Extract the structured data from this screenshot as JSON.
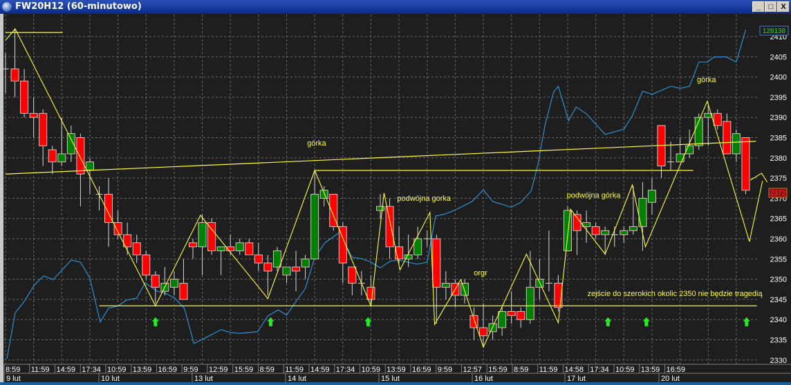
{
  "window": {
    "title": "FW20H12 (60-minutowo)",
    "buttons": {
      "minimize": "_",
      "maximize": "□",
      "close": "X"
    }
  },
  "colors": {
    "background": "#1e1e1e",
    "grid": "#6a6a6a",
    "up_candle": "#008000",
    "down_candle": "#ff0000",
    "candle_border": "#e0c0c0",
    "drawings": "#ffff33",
    "indicator_line": "#2f8fd0",
    "arrows": "#22ee22",
    "axis_text": "#ffffff"
  },
  "chart_data": {
    "type": "candlestick",
    "ylim": [
      2328,
      2413
    ],
    "y_ticks": [
      2330,
      2335,
      2340,
      2345,
      2350,
      2355,
      2360,
      2365,
      2370,
      2375,
      2380,
      2385,
      2390,
      2395,
      2400,
      2405,
      2410
    ],
    "grid": true,
    "x_time_labels": [
      "8:59",
      "11:59",
      "14:59",
      "17:34",
      "10:59",
      "13:59",
      "16:59",
      "9:59",
      "12:59",
      "15:59",
      "8:59",
      "11:59",
      "14:59",
      "17:34",
      "10:59",
      "13:59",
      "16:59",
      "9:59",
      "12:57",
      "15:59",
      "8:59",
      "11:59",
      "14:58",
      "17:34",
      "10:59",
      "13:59",
      "16:59"
    ],
    "x_date_labels": [
      {
        "label": "9 lut",
        "candle": 0
      },
      {
        "label": "10 lut",
        "candle": 10
      },
      {
        "label": "13 lut",
        "candle": 20
      },
      {
        "label": "14 lut",
        "candle": 30
      },
      {
        "label": "15 lut",
        "candle": 40
      },
      {
        "label": "16 lut",
        "candle": 50
      },
      {
        "label": "17 lut",
        "candle": 60
      },
      {
        "label": "20 lut",
        "candle": 70
      }
    ],
    "candles_ohlc": [
      [
        2402,
        2406,
        2396,
        2402
      ],
      [
        2402,
        2412,
        2395,
        2399
      ],
      [
        2399,
        2402,
        2390,
        2391
      ],
      [
        2391,
        2395,
        2385,
        2390
      ],
      [
        2391,
        2392,
        2378,
        2383
      ],
      [
        2382,
        2383,
        2376,
        2379
      ],
      [
        2379,
        2390,
        2378,
        2381
      ],
      [
        2381,
        2388,
        2379,
        2386
      ],
      [
        2385,
        2386,
        2368,
        2376
      ],
      [
        2377,
        2380,
        2371,
        2379
      ],
      [
        2371,
        2373,
        2367,
        2371
      ],
      [
        2371,
        2375,
        2358,
        2364
      ],
      [
        2364,
        2367,
        2360,
        2361
      ],
      [
        2361,
        2364,
        2356,
        2358
      ],
      [
        2359,
        2361,
        2354,
        2356
      ],
      [
        2356,
        2357,
        2350,
        2351
      ],
      [
        2351,
        2352,
        2344,
        2348
      ],
      [
        2347,
        2353,
        2346,
        2349
      ],
      [
        2348,
        2352,
        2346,
        2350
      ],
      [
        2349,
        2355,
        2345,
        2345
      ],
      [
        2359,
        2360,
        2355,
        2358
      ],
      [
        2358,
        2366,
        2351,
        2364
      ],
      [
        2364,
        2365,
        2356,
        2357
      ],
      [
        2357,
        2358,
        2351,
        2358
      ],
      [
        2358,
        2361,
        2356,
        2357
      ],
      [
        2357,
        2360,
        2356,
        2359
      ],
      [
        2359,
        2360,
        2356,
        2356
      ],
      [
        2356,
        2359,
        2352,
        2354
      ],
      [
        2354,
        2356,
        2346,
        2352
      ],
      [
        2353,
        2358,
        2352,
        2357
      ],
      [
        2351,
        2353,
        2349,
        2353
      ],
      [
        2353,
        2357,
        2347,
        2352
      ],
      [
        2353,
        2356,
        2350,
        2355
      ],
      [
        2355,
        2377,
        2355,
        2371
      ],
      [
        2370,
        2373,
        2368,
        2372
      ],
      [
        2371,
        2371,
        2362,
        2363
      ],
      [
        2363,
        2364,
        2349,
        2354
      ],
      [
        2353,
        2353,
        2346,
        2349
      ],
      [
        2349,
        2352,
        2346,
        2349
      ],
      [
        2348,
        2351,
        2344,
        2345
      ],
      [
        2367,
        2371,
        2365,
        2368
      ],
      [
        2368,
        2370,
        2355,
        2358
      ],
      [
        2358,
        2363,
        2354,
        2355
      ],
      [
        2355,
        2361,
        2353,
        2356
      ],
      [
        2356,
        2363,
        2355,
        2360
      ],
      [
        2360,
        2362,
        2358,
        2360
      ],
      [
        2360,
        2361,
        2339,
        2348
      ],
      [
        2348,
        2352,
        2345,
        2349
      ],
      [
        2349,
        2350,
        2343,
        2346
      ],
      [
        2346,
        2350,
        2344,
        2349
      ],
      [
        2341,
        2343,
        2335,
        2338
      ],
      [
        2338,
        2344,
        2333,
        2336
      ],
      [
        2337,
        2341,
        2335,
        2339
      ],
      [
        2338,
        2343,
        2336,
        2342
      ],
      [
        2342,
        2347,
        2339,
        2341
      ],
      [
        2342,
        2343,
        2338,
        2340
      ],
      [
        2340,
        2357,
        2339,
        2348
      ],
      [
        2348,
        2355,
        2345,
        2350
      ],
      [
        2349,
        2362,
        2347,
        2349
      ],
      [
        2349,
        2351,
        2342,
        2343
      ],
      [
        2357,
        2368,
        2357,
        2367
      ],
      [
        2366,
        2367,
        2356,
        2362
      ],
      [
        2363,
        2367,
        2359,
        2364
      ],
      [
        2363,
        2364,
        2360,
        2361
      ],
      [
        2361,
        2363,
        2356,
        2362
      ],
      [
        2361,
        2363,
        2358,
        2361
      ],
      [
        2361,
        2363,
        2359,
        2362
      ],
      [
        2362,
        2373,
        2361,
        2363
      ],
      [
        2363,
        2374,
        2357,
        2370
      ],
      [
        2369,
        2375,
        2366,
        2372
      ],
      [
        2388,
        2388,
        2375,
        2378
      ],
      [
        2379,
        2384,
        2377,
        2379
      ],
      [
        2379,
        2385,
        2379,
        2381
      ],
      [
        2381,
        2387,
        2380,
        2383
      ],
      [
        2383,
        2391,
        2382,
        2390
      ],
      [
        2390,
        2393,
        2383,
        2391
      ],
      [
        2391,
        2392,
        2387,
        2388
      ],
      [
        2389,
        2391,
        2381,
        2381
      ],
      [
        2381,
        2387,
        2379,
        2386
      ],
      [
        2385,
        2385,
        2371,
        2372
      ]
    ],
    "last_price": "2372",
    "indicator": {
      "last_value": "128138",
      "points": [
        [
          0.15,
          2330.3
        ],
        [
          1.03,
          2341.7
        ],
        [
          1.85,
          2344.0
        ],
        [
          3.1,
          2348.6
        ],
        [
          4.06,
          2350.8
        ],
        [
          5.09,
          2349.9
        ],
        [
          7.0,
          2354.7
        ],
        [
          8.0,
          2354.2
        ],
        [
          9.0,
          2350.3
        ],
        [
          10.1,
          2339.4
        ],
        [
          11.0,
          2342.8
        ],
        [
          12.0,
          2343.4
        ],
        [
          12.9,
          2344.8
        ],
        [
          14.0,
          2345.3
        ],
        [
          14.9,
          2349.1
        ],
        [
          16.2,
          2347.0
        ],
        [
          17.1,
          2346.5
        ],
        [
          18.1,
          2345.2
        ],
        [
          19.1,
          2342.8
        ],
        [
          20.1,
          2334.1
        ],
        [
          21.0,
          2335.1
        ],
        [
          23.0,
          2337.5
        ],
        [
          24.0,
          2336.8
        ],
        [
          25.0,
          2336.6
        ],
        [
          26.9,
          2337.0
        ],
        [
          28.0,
          2340.9
        ],
        [
          29.1,
          2342.4
        ],
        [
          30.0,
          2341.1
        ],
        [
          31.0,
          2344.5
        ],
        [
          32.0,
          2347.7
        ],
        [
          33.0,
          2355.4
        ],
        [
          34.1,
          2359.0
        ],
        [
          35.6,
          2361.5
        ],
        [
          37.0,
          2355.4
        ],
        [
          38.0,
          2355.1
        ],
        [
          39.0,
          2354.2
        ],
        [
          40.0,
          2352.8
        ],
        [
          41.1,
          2354.5
        ],
        [
          42.0,
          2354.7
        ],
        [
          43.9,
          2353.7
        ],
        [
          45.0,
          2354.2
        ],
        [
          45.9,
          2365.6
        ],
        [
          46.9,
          2366.1
        ],
        [
          47.9,
          2367.0
        ],
        [
          49.8,
          2369.2
        ],
        [
          51.0,
          2372.1
        ],
        [
          52.0,
          2369.2
        ],
        [
          54.0,
          2367.8
        ],
        [
          55.0,
          2369.0
        ],
        [
          56.1,
          2371.8
        ],
        [
          56.8,
          2378.1
        ],
        [
          57.6,
          2388.3
        ],
        [
          58.5,
          2396.3
        ],
        [
          59.0,
          2397.7
        ],
        [
          60.1,
          2389.2
        ],
        [
          60.9,
          2392.6
        ],
        [
          62.0,
          2390.9
        ],
        [
          64.0,
          2385.8
        ],
        [
          66.0,
          2387.1
        ],
        [
          66.9,
          2390.4
        ],
        [
          68.0,
          2396.5
        ],
        [
          69.0,
          2395.7
        ],
        [
          71.0,
          2397.7
        ],
        [
          72.0,
          2397.2
        ],
        [
          73.0,
          2397.7
        ],
        [
          74.0,
          2403.7
        ],
        [
          74.9,
          2403.7
        ],
        [
          75.6,
          2404.9
        ],
        [
          76.9,
          2405.0
        ],
        [
          78.0,
          2403.7
        ],
        [
          79.0,
          2411.7
        ]
      ]
    },
    "drawings": {
      "zigzag": [
        [
          0,
          2409.1
        ],
        [
          1.03,
          2411.9
        ],
        [
          16.0,
          2343.4
        ],
        [
          20.8,
          2365.8
        ],
        [
          28.0,
          2345.2
        ],
        [
          33.0,
          2376.9
        ],
        [
          39.0,
          2343.4
        ],
        [
          40.4,
          2371.3
        ],
        [
          42.1,
          2352.3
        ],
        [
          45.3,
          2366.5
        ],
        [
          45.8,
          2338.8
        ],
        [
          48.6,
          2349.9
        ],
        [
          51.0,
          2333.2
        ],
        [
          55.6,
          2356.2
        ],
        [
          59.0,
          2339.2
        ],
        [
          60.3,
          2367.3
        ],
        [
          64.0,
          2356.2
        ],
        [
          66.9,
          2373.3
        ],
        [
          68.3,
          2358.0
        ],
        [
          74.9,
          2394.0
        ],
        [
          79.4,
          2359.3
        ],
        [
          80.8,
          2374.3
        ]
      ],
      "lines": [
        [
          [
            0,
            2411.0
          ],
          [
            6.1,
            2411.0
          ]
        ],
        [
          [
            0,
            2376.0
          ],
          [
            80.1,
            2384.1
          ]
        ],
        [
          [
            33.0,
            2376.9
          ],
          [
            73.4,
            2376.9
          ]
        ],
        [
          [
            10.0,
            2343.4
          ],
          [
            80.2,
            2343.4
          ]
        ]
      ],
      "labels": [
        {
          "text": "górka",
          "candle": 33.2,
          "price": 2383.7,
          "anchor": "middle"
        },
        {
          "text": "podwójna gorka",
          "candle": 41.8,
          "price": 2370.1,
          "anchor": "start"
        },
        {
          "text": "orgr",
          "candle": 50.7,
          "price": 2351.6,
          "anchor": "middle"
        },
        {
          "text": "podwójna górka",
          "candle": 59.9,
          "price": 2370.8,
          "anchor": "start"
        },
        {
          "text": "górka",
          "candle": 73.8,
          "price": 2399.4,
          "anchor": "start"
        },
        {
          "text": "zejście do szerokich okolic 2350 nie będzie tragedią",
          "candle": 62.1,
          "price": 2346.5,
          "anchor": "start"
        }
      ],
      "buy_arrows": [
        16.0,
        28.3,
        38.7,
        64.3,
        68.4,
        79.1
      ],
      "arrow_price": 2339.4
    }
  }
}
